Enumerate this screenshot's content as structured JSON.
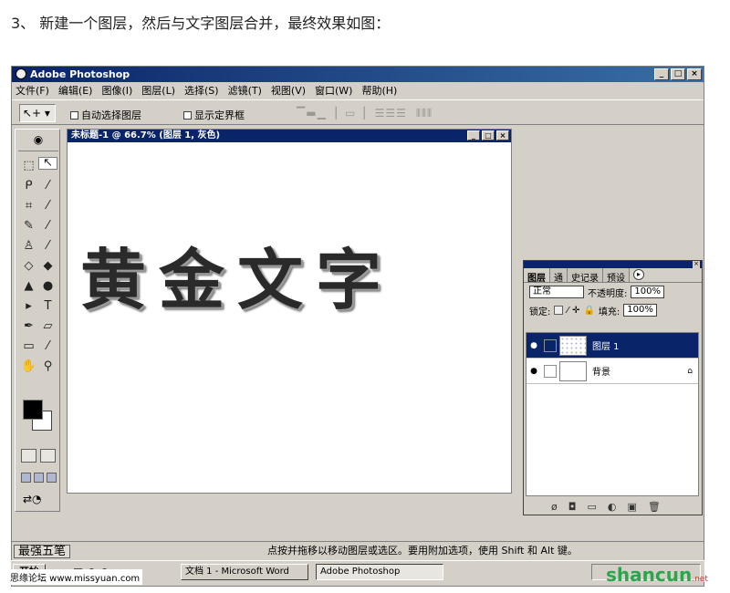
{
  "step_text": "3、 新建一个图层，然后与文字图层合并，最终效果如图：",
  "app": {
    "title": "Adobe Photoshop",
    "menu": [
      "文件(F)",
      "编辑(E)",
      "图像(I)",
      "图层(L)",
      "选择(S)",
      "滤镜(T)",
      "视图(V)",
      "窗口(W)",
      "帮助(H)"
    ],
    "options": {
      "auto_select": "自动选择图层",
      "show_bounds": "显示定界框"
    },
    "window_buttons": [
      "_",
      "□",
      "×"
    ]
  },
  "document": {
    "title": "未标题-1 @ 66.7% (图层 1, 灰色)",
    "artwork_text": "黄金文字"
  },
  "layers_panel": {
    "tabs": [
      "图层",
      "通",
      "史记录",
      "预设"
    ],
    "blend_mode": "正常",
    "opacity_label": "不透明度:",
    "opacity_value": "100%",
    "lock_label": "锁定:",
    "fill_label": "填充:",
    "fill_value": "100%",
    "layers": [
      {
        "name": "图层 1",
        "active": true
      },
      {
        "name": "背景",
        "active": false,
        "locked": true
      }
    ]
  },
  "status": {
    "ime_label": "最强五笔",
    "message": "点按并拖移以移动图层或选区。要用附加选项，使用 Shift 和 Alt 键。"
  },
  "taskbar": {
    "start_label": "开始",
    "tasks": [
      "文档 1 - Microsoft Word",
      "Adobe Photoshop"
    ]
  },
  "watermarks": {
    "left": "思缘论坛 www.missyuan.com",
    "right": "shancun",
    "right_suffix": ".net"
  }
}
